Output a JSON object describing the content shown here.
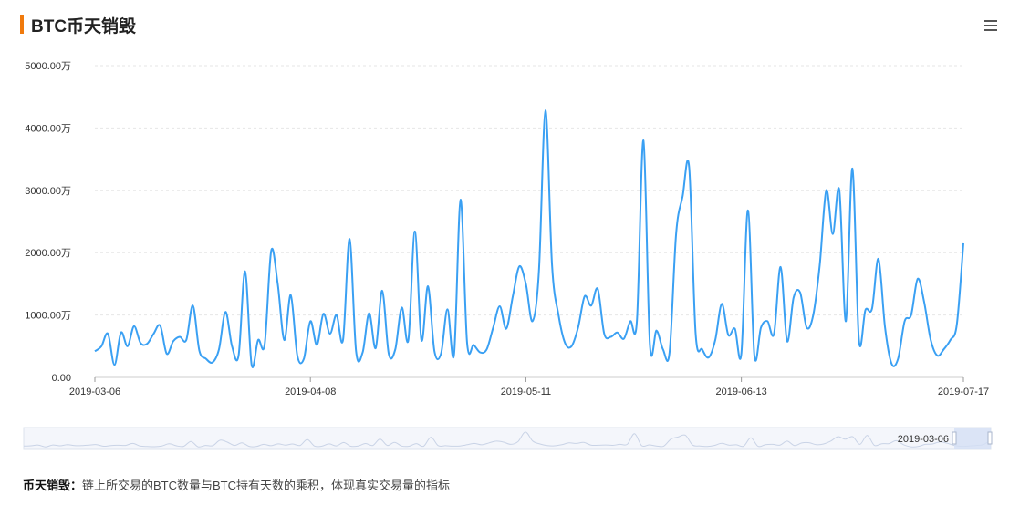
{
  "header": {
    "title": "BTC币天销毁"
  },
  "footer": {
    "term": "币天销毁：",
    "description": "链上所交易的BTC数量与BTC持有天数的乘积，体现真实交易量的指标"
  },
  "zoom": {
    "start_label": "2019-03-06"
  },
  "colors": {
    "accent": "#f07a0d",
    "line": "#3aa0f3",
    "grid": "#e6e6e6"
  },
  "chart_data": {
    "type": "line",
    "title": "BTC币天销毁",
    "ylim": [
      0,
      5000
    ],
    "y_ticks": [
      "0.00",
      "1000.00万",
      "2000.00万",
      "3000.00万",
      "4000.00万",
      "5000.00万"
    ],
    "x_ticks": [
      "2019-03-06",
      "2019-04-08",
      "2019-05-11",
      "2019-06-13",
      "2019-07-17"
    ],
    "x_range": [
      "2019-03-06",
      "2019-07-17"
    ],
    "grid": true,
    "series": [
      {
        "points": [
          [
            "2019-03-06",
            420
          ],
          [
            "2019-03-07",
            500
          ],
          [
            "2019-03-08",
            700
          ],
          [
            "2019-03-09",
            200
          ],
          [
            "2019-03-10",
            720
          ],
          [
            "2019-03-11",
            500
          ],
          [
            "2019-03-12",
            820
          ],
          [
            "2019-03-13",
            550
          ],
          [
            "2019-03-14",
            540
          ],
          [
            "2019-03-15",
            700
          ],
          [
            "2019-03-16",
            830
          ],
          [
            "2019-03-17",
            380
          ],
          [
            "2019-03-18",
            580
          ],
          [
            "2019-03-19",
            650
          ],
          [
            "2019-03-20",
            600
          ],
          [
            "2019-03-21",
            1150
          ],
          [
            "2019-03-22",
            430
          ],
          [
            "2019-03-23",
            300
          ],
          [
            "2019-03-24",
            240
          ],
          [
            "2019-03-25",
            450
          ],
          [
            "2019-03-26",
            1050
          ],
          [
            "2019-03-27",
            500
          ],
          [
            "2019-03-28",
            350
          ],
          [
            "2019-03-29",
            1700
          ],
          [
            "2019-03-30",
            200
          ],
          [
            "2019-03-31",
            600
          ],
          [
            "2019-04-01",
            530
          ],
          [
            "2019-04-02",
            2030
          ],
          [
            "2019-04-03",
            1500
          ],
          [
            "2019-04-04",
            600
          ],
          [
            "2019-04-05",
            1320
          ],
          [
            "2019-04-06",
            350
          ],
          [
            "2019-04-07",
            300
          ],
          [
            "2019-04-08",
            900
          ],
          [
            "2019-04-09",
            520
          ],
          [
            "2019-04-10",
            1020
          ],
          [
            "2019-04-11",
            700
          ],
          [
            "2019-04-12",
            1000
          ],
          [
            "2019-04-13",
            600
          ],
          [
            "2019-04-14",
            2220
          ],
          [
            "2019-04-15",
            420
          ],
          [
            "2019-04-16",
            400
          ],
          [
            "2019-04-17",
            1030
          ],
          [
            "2019-04-18",
            470
          ],
          [
            "2019-04-19",
            1390
          ],
          [
            "2019-04-20",
            380
          ],
          [
            "2019-04-21",
            450
          ],
          [
            "2019-04-22",
            1120
          ],
          [
            "2019-04-23",
            600
          ],
          [
            "2019-04-24",
            2340
          ],
          [
            "2019-04-25",
            600
          ],
          [
            "2019-04-26",
            1460
          ],
          [
            "2019-04-27",
            420
          ],
          [
            "2019-04-28",
            380
          ],
          [
            "2019-04-29",
            1090
          ],
          [
            "2019-04-30",
            370
          ],
          [
            "2019-05-01",
            2850
          ],
          [
            "2019-05-02",
            550
          ],
          [
            "2019-05-03",
            520
          ],
          [
            "2019-05-04",
            400
          ],
          [
            "2019-05-05",
            450
          ],
          [
            "2019-05-06",
            800
          ],
          [
            "2019-05-07",
            1140
          ],
          [
            "2019-05-08",
            780
          ],
          [
            "2019-05-09",
            1300
          ],
          [
            "2019-05-10",
            1780
          ],
          [
            "2019-05-11",
            1500
          ],
          [
            "2019-05-12",
            900
          ],
          [
            "2019-05-13",
            1700
          ],
          [
            "2019-05-14",
            4280
          ],
          [
            "2019-05-15",
            1800
          ],
          [
            "2019-05-16",
            1000
          ],
          [
            "2019-05-17",
            550
          ],
          [
            "2019-05-18",
            500
          ],
          [
            "2019-05-19",
            800
          ],
          [
            "2019-05-20",
            1300
          ],
          [
            "2019-05-21",
            1150
          ],
          [
            "2019-05-22",
            1420
          ],
          [
            "2019-05-23",
            700
          ],
          [
            "2019-05-24",
            650
          ],
          [
            "2019-05-25",
            720
          ],
          [
            "2019-05-26",
            620
          ],
          [
            "2019-05-27",
            900
          ],
          [
            "2019-05-28",
            900
          ],
          [
            "2019-05-29",
            3800
          ],
          [
            "2019-05-30",
            520
          ],
          [
            "2019-05-31",
            750
          ],
          [
            "2019-06-01",
            450
          ],
          [
            "2019-06-02",
            400
          ],
          [
            "2019-06-03",
            2300
          ],
          [
            "2019-06-04",
            2900
          ],
          [
            "2019-06-05",
            3370
          ],
          [
            "2019-06-06",
            700
          ],
          [
            "2019-06-07",
            450
          ],
          [
            "2019-06-08",
            320
          ],
          [
            "2019-06-09",
            600
          ],
          [
            "2019-06-10",
            1180
          ],
          [
            "2019-06-11",
            680
          ],
          [
            "2019-06-12",
            780
          ],
          [
            "2019-06-13",
            380
          ],
          [
            "2019-06-14",
            2680
          ],
          [
            "2019-06-15",
            350
          ],
          [
            "2019-06-16",
            800
          ],
          [
            "2019-06-17",
            900
          ],
          [
            "2019-06-18",
            700
          ],
          [
            "2019-06-19",
            1770
          ],
          [
            "2019-06-20",
            580
          ],
          [
            "2019-06-21",
            1280
          ],
          [
            "2019-06-22",
            1360
          ],
          [
            "2019-06-23",
            800
          ],
          [
            "2019-06-24",
            1000
          ],
          [
            "2019-06-25",
            1800
          ],
          [
            "2019-06-26",
            3000
          ],
          [
            "2019-06-27",
            2300
          ],
          [
            "2019-06-28",
            3000
          ],
          [
            "2019-06-29",
            900
          ],
          [
            "2019-06-30",
            3350
          ],
          [
            "2019-07-01",
            600
          ],
          [
            "2019-07-02",
            1080
          ],
          [
            "2019-07-03",
            1100
          ],
          [
            "2019-07-04",
            1900
          ],
          [
            "2019-07-05",
            800
          ],
          [
            "2019-07-06",
            220
          ],
          [
            "2019-07-07",
            300
          ],
          [
            "2019-07-08",
            900
          ],
          [
            "2019-07-09",
            1000
          ],
          [
            "2019-07-10",
            1580
          ],
          [
            "2019-07-11",
            1200
          ],
          [
            "2019-07-12",
            600
          ],
          [
            "2019-07-13",
            350
          ],
          [
            "2019-07-14",
            450
          ],
          [
            "2019-07-15",
            600
          ],
          [
            "2019-07-16",
            850
          ],
          [
            "2019-07-17",
            2150
          ]
        ]
      }
    ]
  }
}
